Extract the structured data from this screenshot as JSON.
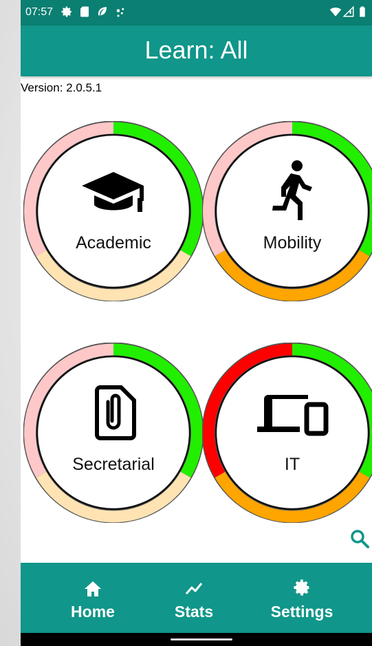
{
  "status_bar": {
    "time": "07:57",
    "icons": [
      "gear-icon",
      "sd-card-icon",
      "leaf-icon",
      "dots-icon",
      "wifi-icon",
      "signal-icon",
      "battery-icon"
    ]
  },
  "app_bar": {
    "title": "Learn: All"
  },
  "version": "Version: 2.0.5.1",
  "categories": [
    {
      "label": "Academic",
      "icon": "graduation-cap-icon"
    },
    {
      "label": "Mobility",
      "icon": "running-person-icon"
    },
    {
      "label": "Secretarial",
      "icon": "paperclip-document-icon"
    },
    {
      "label": "IT",
      "icon": "devices-icon"
    }
  ],
  "colors": {
    "primary": "#10968a",
    "status_bar": "#0a7f72",
    "green": "#22ee00",
    "orange": "#ffa500",
    "red": "#ff0000",
    "pink_faded": "#ffc8c8",
    "orange_faded": "#ffe3b3"
  },
  "nav": {
    "home": "Home",
    "stats": "Stats",
    "settings": "Settings"
  }
}
